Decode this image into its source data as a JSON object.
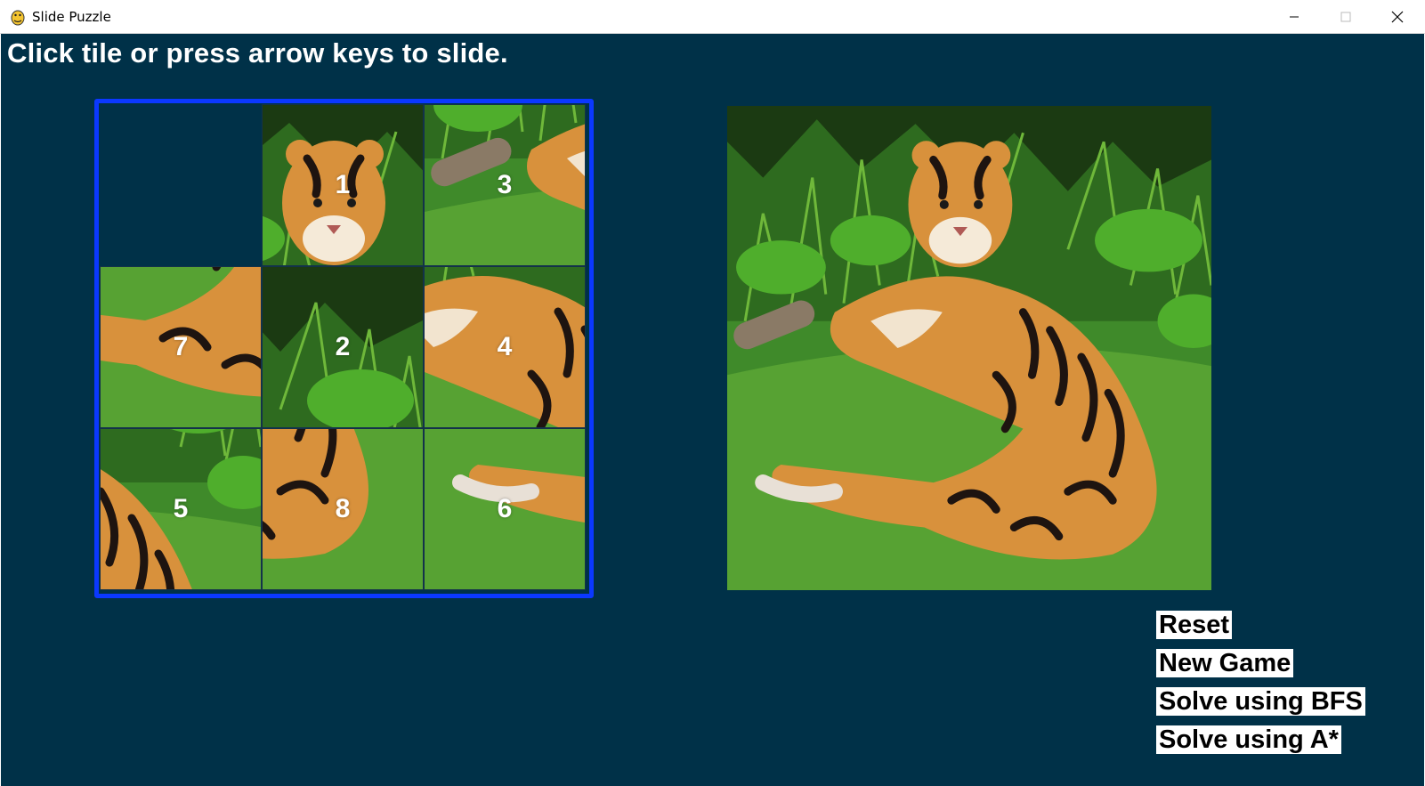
{
  "window": {
    "title": "Slide Puzzle",
    "controls": {
      "minimize": "minimize-icon",
      "maximize": "maximize-icon",
      "close": "close-icon"
    }
  },
  "game": {
    "instructions": "Click tile or press arrow keys to slide.",
    "board": {
      "grid_size": 3,
      "empty_position": "top-left",
      "tiles": [
        {
          "label": ""
        },
        {
          "label": "1"
        },
        {
          "label": "3"
        },
        {
          "label": "7"
        },
        {
          "label": "2"
        },
        {
          "label": "4"
        },
        {
          "label": "5"
        },
        {
          "label": "8"
        },
        {
          "label": "6"
        }
      ]
    },
    "reference_image": "tiger-lying-in-grass",
    "buttons": {
      "reset": "Reset",
      "new_game": "New Game",
      "solve_bfs": "Solve using BFS",
      "solve_astar": "Solve using A*"
    }
  },
  "colors": {
    "background": "#003148",
    "board_border": "#0b38ff",
    "tile_number": "#ffffff",
    "button_bg": "#ffffff",
    "button_text": "#000000"
  }
}
